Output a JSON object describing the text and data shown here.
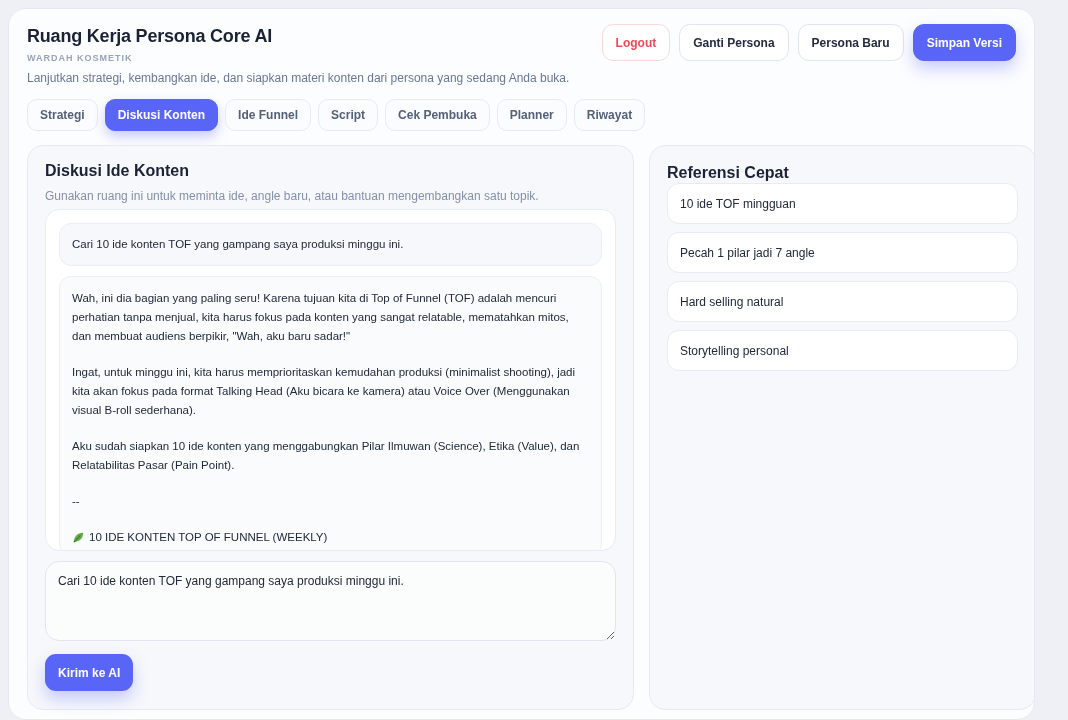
{
  "header": {
    "title": "Ruang Kerja Persona Core AI",
    "brand": "WARDAH KOSMETIK",
    "subtitle": "Lanjutkan strategi, kembangkan ide, dan siapkan materi konten dari persona yang sedang Anda buka.",
    "actions": [
      {
        "label": "Logout",
        "kind": "danger"
      },
      {
        "label": "Ganti Persona",
        "kind": "plain"
      },
      {
        "label": "Persona Baru",
        "kind": "plain"
      },
      {
        "label": "Simpan Versi",
        "kind": "primary"
      }
    ]
  },
  "tabs": [
    {
      "label": "Strategi",
      "selected": false
    },
    {
      "label": "Diskusi Konten",
      "selected": true
    },
    {
      "label": "Ide Funnel",
      "selected": false
    },
    {
      "label": "Script",
      "selected": false
    },
    {
      "label": "Cek Pembuka",
      "selected": false
    },
    {
      "label": "Planner",
      "selected": false
    },
    {
      "label": "Riwayat",
      "selected": false
    }
  ],
  "chat": {
    "title": "Diskusi Ide Konten",
    "hint": "Gunakan ruang ini untuk meminta ide, angle baru, atau bantuan mengembangkan satu topik.",
    "messages": [
      {
        "kind": "user",
        "paragraphs": [
          "Cari 10 ide konten TOF yang gampang saya produksi minggu ini."
        ]
      },
      {
        "kind": "assistant",
        "paragraphs": [
          "Wah, ini dia bagian yang paling seru! Karena tujuan kita di Top of Funnel (TOF) adalah mencuri perhatian tanpa menjual, kita harus fokus pada konten yang sangat relatable, mematahkan mitos, dan membuat audiens berpikir, \"Wah, aku baru sadar!\"",
          "Ingat, untuk minggu ini, kita harus memprioritaskan kemudahan produksi (minimalist shooting), jadi kita akan fokus pada format Talking Head (Aku bicara ke kamera) atau Voice Over (Menggunakan visual B-roll sederhana).",
          "Aku sudah siapkan 10 ide konten yang menggabungkan Pilar Ilmuwan (Science), Etika (Value), dan Relatabilitas Pasar (Pain Point).",
          "--"
        ],
        "heading": "10 IDE KONTEN TOP OF FUNNEL (WEEKLY)"
      }
    ],
    "input": {
      "value": "Cari 10 ide konten TOF yang gampang saya produksi minggu ini."
    },
    "send": "Kirim ke AI"
  },
  "references": {
    "title": "Referensi Cepat",
    "items": [
      "10 ide TOF mingguan",
      "Pecah 1 pilar jadi 7 angle",
      "Hard selling natural",
      "Storytelling personal"
    ]
  }
}
